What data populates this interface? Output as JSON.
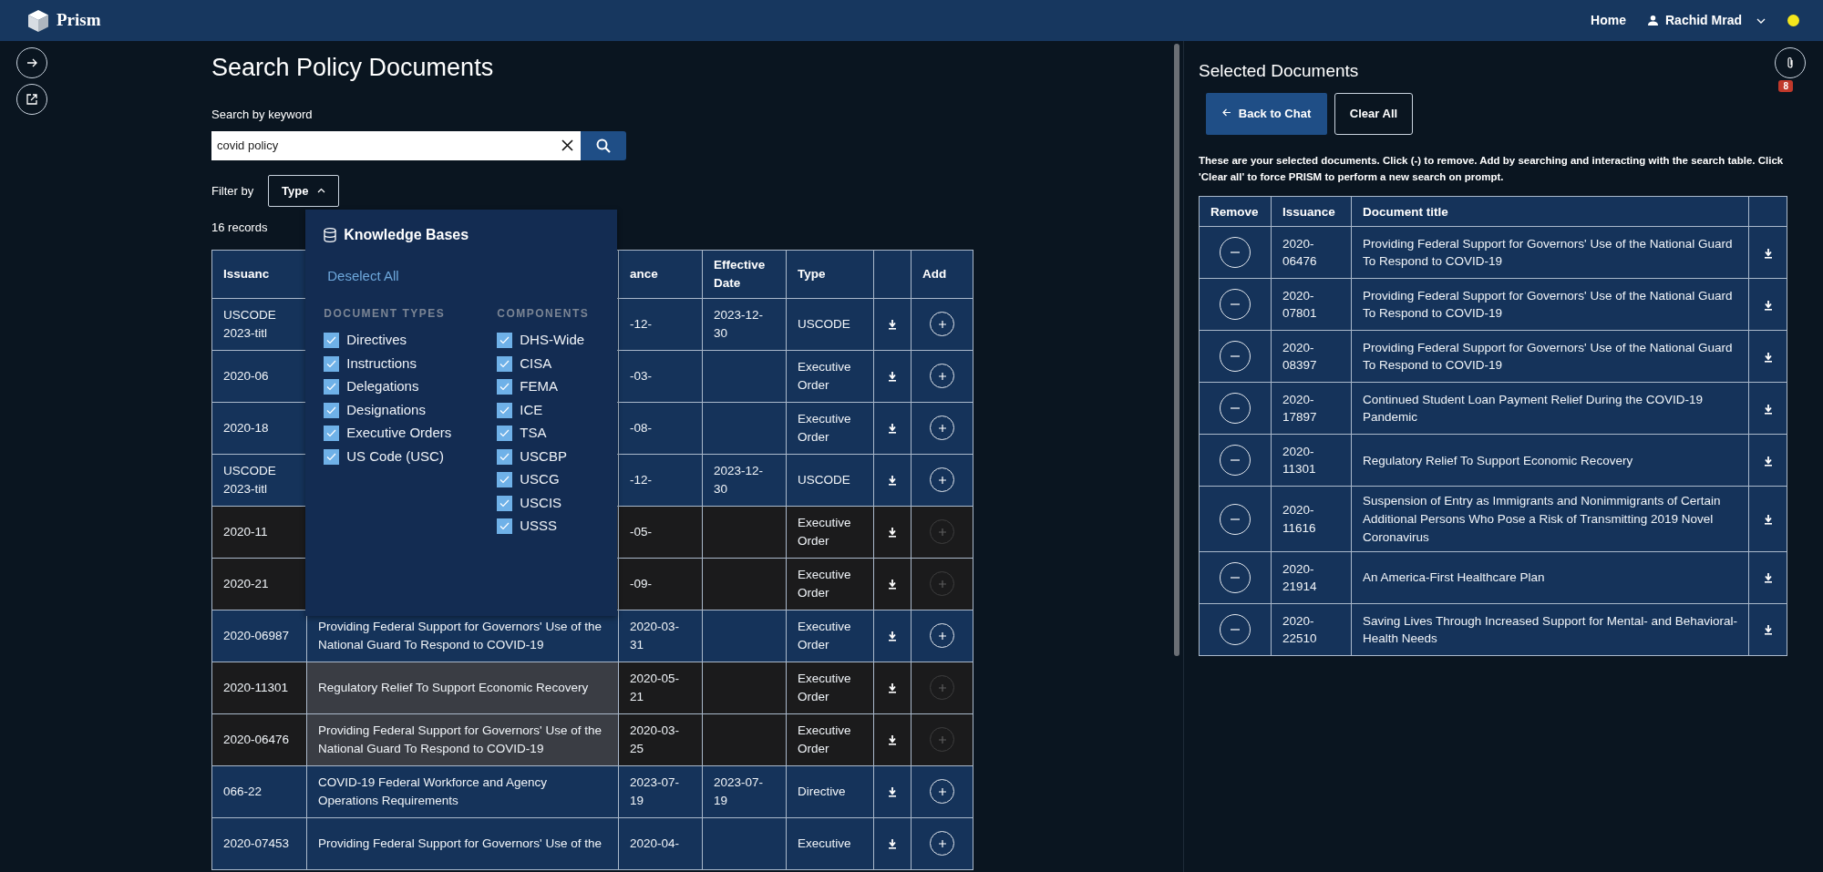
{
  "app": {
    "name": "Prism"
  },
  "nav": {
    "links": [
      {
        "label": "Home"
      }
    ],
    "user": {
      "name": "Rachid Mrad"
    }
  },
  "search_panel": {
    "title": "Search Policy Documents",
    "search_label": "Search by keyword",
    "search_value": "covid policy",
    "filter_label": "Filter by",
    "filter_button": {
      "label": "Type",
      "expanded": true
    },
    "records": "16 records"
  },
  "filter_menu": {
    "title": "Knowledge Bases",
    "deselect": "Deselect All",
    "groups": [
      {
        "heading": "DOCUMENT TYPES",
        "options": [
          {
            "label": "Directives",
            "checked": true
          },
          {
            "label": "Instructions",
            "checked": true
          },
          {
            "label": "Delegations",
            "checked": true
          },
          {
            "label": "Designations",
            "checked": true
          },
          {
            "label": "Executive Orders",
            "checked": true
          },
          {
            "label": "US Code (USC)",
            "checked": true
          }
        ]
      },
      {
        "heading": "COMPONENTS",
        "options": [
          {
            "label": "DHS-Wide",
            "checked": true
          },
          {
            "label": "CISA",
            "checked": true
          },
          {
            "label": "FEMA",
            "checked": true
          },
          {
            "label": "ICE",
            "checked": true
          },
          {
            "label": "TSA",
            "checked": true
          },
          {
            "label": "USCBP",
            "checked": true
          },
          {
            "label": "USCG",
            "checked": true
          },
          {
            "label": "USCIS",
            "checked": true
          },
          {
            "label": "USSS",
            "checked": true
          }
        ]
      }
    ]
  },
  "results_table": {
    "columns": {
      "issuance": "Issuanc",
      "issuance_date": "ance",
      "effective_date": "Effective Date",
      "type": "Type",
      "add": "Add"
    },
    "rows": [
      {
        "issuance": "USCODE 2023-titl",
        "issuance_date": "-12-",
        "effective_date": "2023-12-30",
        "type": "USCODE",
        "added": false
      },
      {
        "issuance": "2020-06",
        "issuance_date": "-03-",
        "type": "Executive Order",
        "added": false
      },
      {
        "issuance": "2020-18",
        "issuance_date": "-08-",
        "type": "Executive Order",
        "added": false
      },
      {
        "issuance": "USCODE 2023-titl",
        "issuance_date": "-12-",
        "effective_date": "2023-12-30",
        "type": "USCODE",
        "added": false
      },
      {
        "issuance": "2020-11",
        "issuance_date": "-05-",
        "type": "Executive Order",
        "added": true
      },
      {
        "issuance": "2020-21",
        "issuance_date": "-09-",
        "type": "Executive Order",
        "added": true
      },
      {
        "issuance": "2020-06987",
        "title": "Providing Federal Support for Governors' Use of the National Guard To Respond to COVID-19",
        "issuance_date": "2020-03-31",
        "type": "Executive Order",
        "added": false
      },
      {
        "issuance": "2020-11301",
        "title": "Regulatory Relief To Support Economic Recovery",
        "issuance_date": "2020-05-21",
        "type": "Executive Order",
        "added": true
      },
      {
        "issuance": "2020-06476",
        "title": "Providing Federal Support for Governors' Use of the National Guard To Respond to COVID-19",
        "issuance_date": "2020-03-25",
        "type": "Executive Order",
        "added": true
      },
      {
        "issuance": "066-22",
        "title": "COVID-19 Federal Workforce and Agency Operations Requirements",
        "issuance_date": "2023-07-19",
        "effective_date": "2023-07-19",
        "type": "Directive",
        "added": false
      },
      {
        "issuance": "2020-07453",
        "title": "Providing Federal Support for Governors' Use of the",
        "issuance_date": "2020-04-",
        "type": "Executive",
        "added": false
      }
    ]
  },
  "selected_panel": {
    "title": "Selected Documents",
    "attachment_count": "8",
    "back_button": "Back to Chat",
    "clear_button": "Clear All",
    "note": "These are your selected documents. Click (-) to remove. Add by searching and interacting with the search table. Click 'Clear all' to force PRISM to perform a new search on prompt.",
    "table": {
      "columns": [
        "Remove",
        "Issuance",
        "Document title"
      ],
      "rows": [
        {
          "issuance": "2020-06476",
          "title": "Providing Federal Support for Governors' Use of the National Guard To Respond to COVID-19"
        },
        {
          "issuance": "2020-07801",
          "title": "Providing Federal Support for Governors' Use of the National Guard To Respond to COVID-19"
        },
        {
          "issuance": "2020-08397",
          "title": "Providing Federal Support for Governors' Use of the National Guard To Respond to COVID-19"
        },
        {
          "issuance": "2020-17897",
          "title": "Continued Student Loan Payment Relief During the COVID-19 Pandemic"
        },
        {
          "issuance": "2020-11301",
          "title": "Regulatory Relief To Support Economic Recovery"
        },
        {
          "issuance": "2020-11616",
          "title": "Suspension of Entry as Immigrants and Nonimmigrants of Certain Additional Persons Who Pose a Risk of Transmitting 2019 Novel Coronavirus"
        },
        {
          "issuance": "2020-21914",
          "title": "An America-First Healthcare Plan"
        },
        {
          "issuance": "2020-22510",
          "title": "Saving Lives Through Increased Support for Mental- and Behavioral-Health Needs"
        }
      ]
    }
  }
}
